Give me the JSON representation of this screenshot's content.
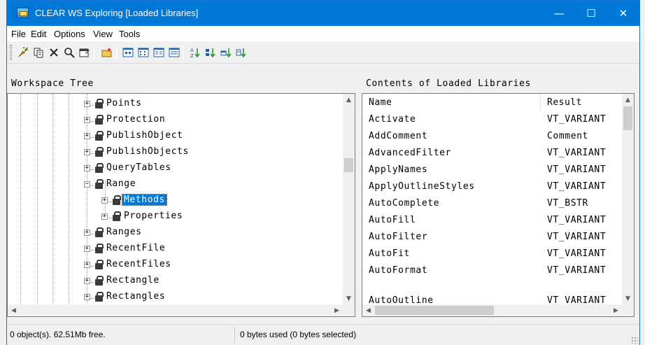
{
  "window": {
    "title": "CLEAR WS Exploring [Loaded Libraries]",
    "controls": {
      "minimize": "—",
      "maximize": "☐",
      "close": "✕"
    }
  },
  "menu": [
    "File",
    "Edit",
    "Options",
    "View",
    "Tools"
  ],
  "toolbar": {
    "icons": [
      "up-folder-icon",
      "copy-icon",
      "delete-icon",
      "find-icon",
      "properties-icon",
      "new-folder-icon",
      "large-icons-view-icon",
      "small-icons-view-icon",
      "list-view-icon",
      "details-view-icon",
      "sort-az-icon",
      "sort-type-icon",
      "sort-size-icon",
      "sort-date-icon"
    ]
  },
  "workspace_tree": {
    "header": "Workspace Tree",
    "items": [
      {
        "label": "Points",
        "expander": "+",
        "selected": false
      },
      {
        "label": "Protection",
        "expander": "+",
        "selected": false
      },
      {
        "label": "PublishObject",
        "expander": "+",
        "selected": false
      },
      {
        "label": "PublishObjects",
        "expander": "+",
        "selected": false
      },
      {
        "label": "QueryTables",
        "expander": "+",
        "selected": false
      },
      {
        "label": "Range",
        "expander": "−",
        "selected": false
      },
      {
        "label": "Methods",
        "expander": "+",
        "selected": true
      },
      {
        "label": "Properties",
        "expander": "+",
        "selected": false
      },
      {
        "label": "Ranges",
        "expander": "+",
        "selected": false
      },
      {
        "label": "RecentFile",
        "expander": "+",
        "selected": false
      },
      {
        "label": "RecentFiles",
        "expander": "+",
        "selected": false
      },
      {
        "label": "Rectangle",
        "expander": "+",
        "selected": false
      },
      {
        "label": "Rectangles",
        "expander": "+",
        "selected": false
      }
    ]
  },
  "contents": {
    "header": "Contents of Loaded Libraries",
    "columns": {
      "name": "Name",
      "result": "Result"
    },
    "rows": [
      {
        "name": "Activate",
        "result": "VT_VARIANT"
      },
      {
        "name": "AddComment",
        "result": "Comment"
      },
      {
        "name": "AdvancedFilter",
        "result": "VT_VARIANT"
      },
      {
        "name": "ApplyNames",
        "result": "VT_VARIANT"
      },
      {
        "name": "ApplyOutlineStyles",
        "result": "VT_VARIANT"
      },
      {
        "name": "AutoComplete",
        "result": "VT_BSTR"
      },
      {
        "name": "AutoFill",
        "result": "VT_VARIANT"
      },
      {
        "name": "AutoFilter",
        "result": "VT_VARIANT"
      },
      {
        "name": "AutoFit",
        "result": "VT_VARIANT"
      },
      {
        "name": "AutoFormat",
        "result": "VT_VARIANT"
      },
      {
        "name": "AutoOutline",
        "result": "VT_VARIANT"
      }
    ]
  },
  "status": {
    "objects": "0 object(s). 62.51Mb free.",
    "bytes": "0 bytes used (0 bytes selected)"
  },
  "colors": {
    "titlebar": "#0078d7",
    "selection": "#0078d7"
  }
}
